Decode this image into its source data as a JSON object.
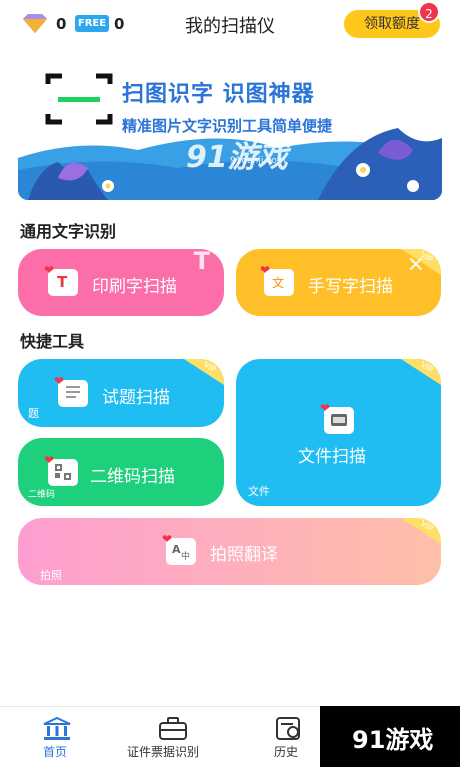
{
  "header": {
    "gem_count": "0",
    "free_badge": "FREE",
    "free_count": "0",
    "title": "我的扫描仪",
    "quota_button": "领取额度",
    "quota_badge": "2"
  },
  "banner": {
    "headline": "扫图识字 识图神器",
    "subline": "精准图片文字识别工具简单便捷",
    "watermark": "91游戏",
    "watermark_url": "91danji.com"
  },
  "sections": {
    "ocr_title": "通用文字识别",
    "tools_title": "快捷工具"
  },
  "cards": {
    "print_scan": {
      "label": "印刷字扫描",
      "corner": "T"
    },
    "handwriting_scan": {
      "label": "手写字扫描",
      "vip": "VIP"
    },
    "exam_scan": {
      "label": "试题扫描",
      "mini": "题",
      "vip": "VIP"
    },
    "qr_scan": {
      "label": "二维码扫描",
      "mini": "二维码"
    },
    "file_scan": {
      "label": "文件扫描",
      "mini": "文件",
      "vip": "VIP"
    },
    "photo_translate": {
      "label": "拍照翻译",
      "mini": "拍照",
      "vip": "VIP"
    }
  },
  "nav": {
    "home": "首页",
    "certificate": "证件票据识别",
    "history": "历史"
  },
  "site_watermark": "91游戏",
  "colors": {
    "accent_blue": "#2b74d8",
    "pink": "#fb6eaa",
    "orange": "#ffbf28",
    "blue": "#1fbdf2",
    "green": "#1ed07c",
    "quota_yellow": "#ffc71a",
    "badge_red": "#f0344a"
  },
  "icons": [
    "gem-icon",
    "scan-frame-icon",
    "text-t-icon",
    "handwrite-icon",
    "exam-icon",
    "qr-icon",
    "folder-icon",
    "translate-icon",
    "home-bank-icon",
    "briefcase-icon",
    "history-icon"
  ]
}
